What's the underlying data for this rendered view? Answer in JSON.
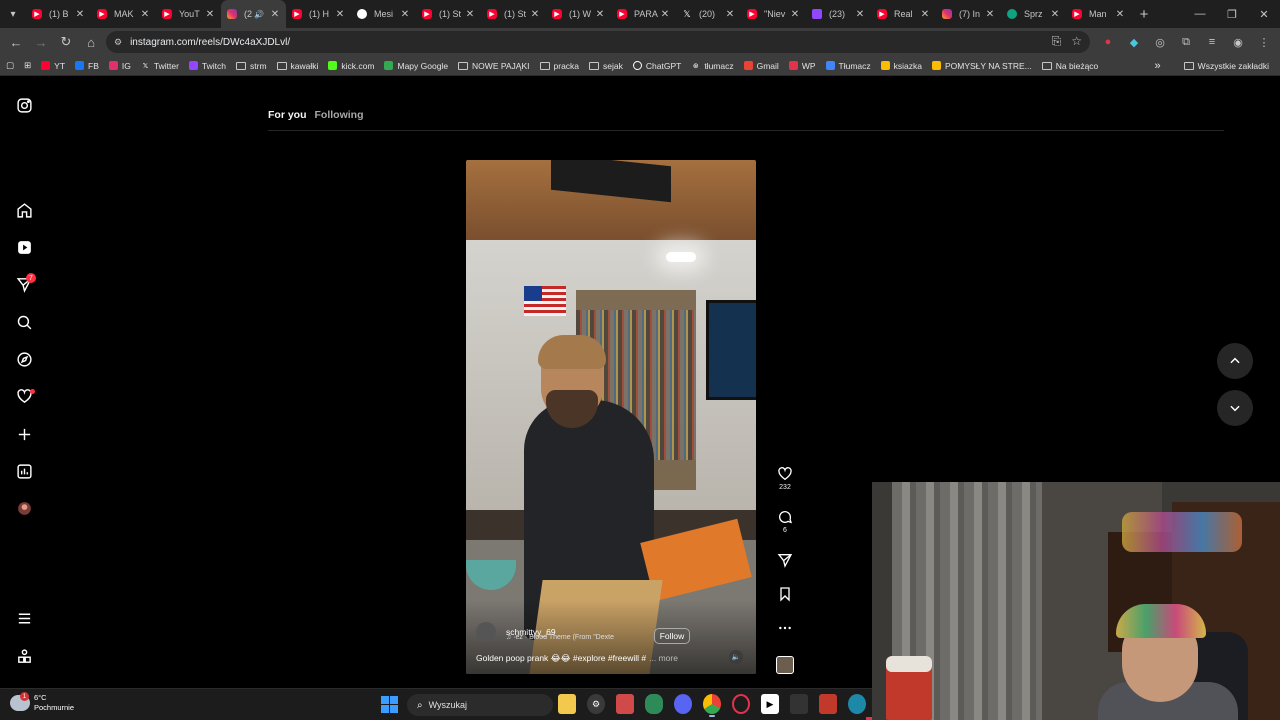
{
  "browser": {
    "tabs": [
      {
        "label": "(1) B",
        "icon": "youtube-icon",
        "active": false
      },
      {
        "label": "MAK",
        "icon": "youtube-icon",
        "active": false
      },
      {
        "label": "YouT",
        "icon": "youtube-icon",
        "active": false
      },
      {
        "label": "(2",
        "icon": "instagram-icon",
        "active": true
      },
      {
        "label": "(1) H",
        "icon": "youtube-icon",
        "active": false
      },
      {
        "label": "Mesi",
        "icon": "messenger-icon",
        "active": false
      },
      {
        "label": "(1) St",
        "icon": "youtube-icon",
        "active": false
      },
      {
        "label": "(1) St",
        "icon": "youtube-icon",
        "active": false
      },
      {
        "label": "(1) W",
        "icon": "youtube-icon",
        "active": false
      },
      {
        "label": "PARA",
        "icon": "youtube-icon",
        "active": false
      },
      {
        "label": "(20)",
        "icon": "x-icon",
        "active": false
      },
      {
        "label": "\"Niev",
        "icon": "youtube-icon",
        "active": false
      },
      {
        "label": "(23)",
        "icon": "twitch-icon",
        "active": false
      },
      {
        "label": "Real",
        "icon": "youtube-icon",
        "active": false
      },
      {
        "label": "(7) In",
        "icon": "instagram-icon",
        "active": false
      },
      {
        "label": "Sprz",
        "icon": "chat-icon",
        "active": false
      },
      {
        "label": "Man",
        "icon": "youtube-icon",
        "active": false
      }
    ],
    "new_tab": "+",
    "url": "instagram.com/reels/DWc4aXJDLvl/",
    "bookmarks": [
      {
        "label": "YT",
        "icon": "youtube-icon",
        "color": "#ff0033"
      },
      {
        "label": "FB",
        "icon": "facebook-icon",
        "color": "#1877f2"
      },
      {
        "label": "IG",
        "icon": "instagram-icon",
        "color": "#e1306c"
      },
      {
        "label": "Twitter",
        "icon": "x-icon",
        "color": "#000000"
      },
      {
        "label": "Twitch",
        "icon": "twitch-icon",
        "color": "#9146ff"
      },
      {
        "label": "strm",
        "icon": "folder-icon",
        "color": ""
      },
      {
        "label": "kawałki",
        "icon": "folder-icon",
        "color": ""
      },
      {
        "label": "kick.com",
        "icon": "kick-icon",
        "color": "#53fc18"
      },
      {
        "label": "Mapy Google",
        "icon": "maps-icon",
        "color": "#34a853"
      },
      {
        "label": "NOWE PAJĄKI",
        "icon": "folder-icon",
        "color": ""
      },
      {
        "label": "pracka",
        "icon": "folder-icon",
        "color": ""
      },
      {
        "label": "sejak",
        "icon": "folder-icon",
        "color": ""
      },
      {
        "label": "ChatGPT",
        "icon": "chatgpt-icon",
        "color": "#ffffff"
      },
      {
        "label": "tłumacz",
        "icon": "translate-icon",
        "color": "#ffffff"
      },
      {
        "label": "Gmail",
        "icon": "gmail-icon",
        "color": "#ea4335"
      },
      {
        "label": "WP",
        "icon": "wp-icon",
        "color": "#e3334b"
      },
      {
        "label": "Tłumacz",
        "icon": "translate-icon",
        "color": "#4285f4"
      },
      {
        "label": "ksiazka",
        "icon": "apps-icon",
        "color": "#fbbc04"
      },
      {
        "label": "POMYSŁY NA STRE...",
        "icon": "apps-icon",
        "color": "#fbbc04"
      },
      {
        "label": "Na bieżąco",
        "icon": "folder-icon",
        "color": ""
      }
    ],
    "bookmarks_more": "»",
    "all_bookmarks": "Wszystkie zakładki"
  },
  "instagram": {
    "feed_tabs": {
      "for_you": "For you",
      "following": "Following"
    },
    "notifications_badge": "7",
    "reel": {
      "username": "schmittyy_69",
      "audio": "♫  ·ez · Blood Theme (From \"Dexte",
      "follow_label": "Follow",
      "caption": "Golden poop prank 😂😂 #explore #freewill #",
      "more_label": "... more",
      "likes": "232",
      "comments": "6"
    }
  },
  "taskbar": {
    "weather_temp": "6°C",
    "weather_desc": "Pochmurnie",
    "weather_badge": "1",
    "search_placeholder": "Wyszukaj"
  }
}
